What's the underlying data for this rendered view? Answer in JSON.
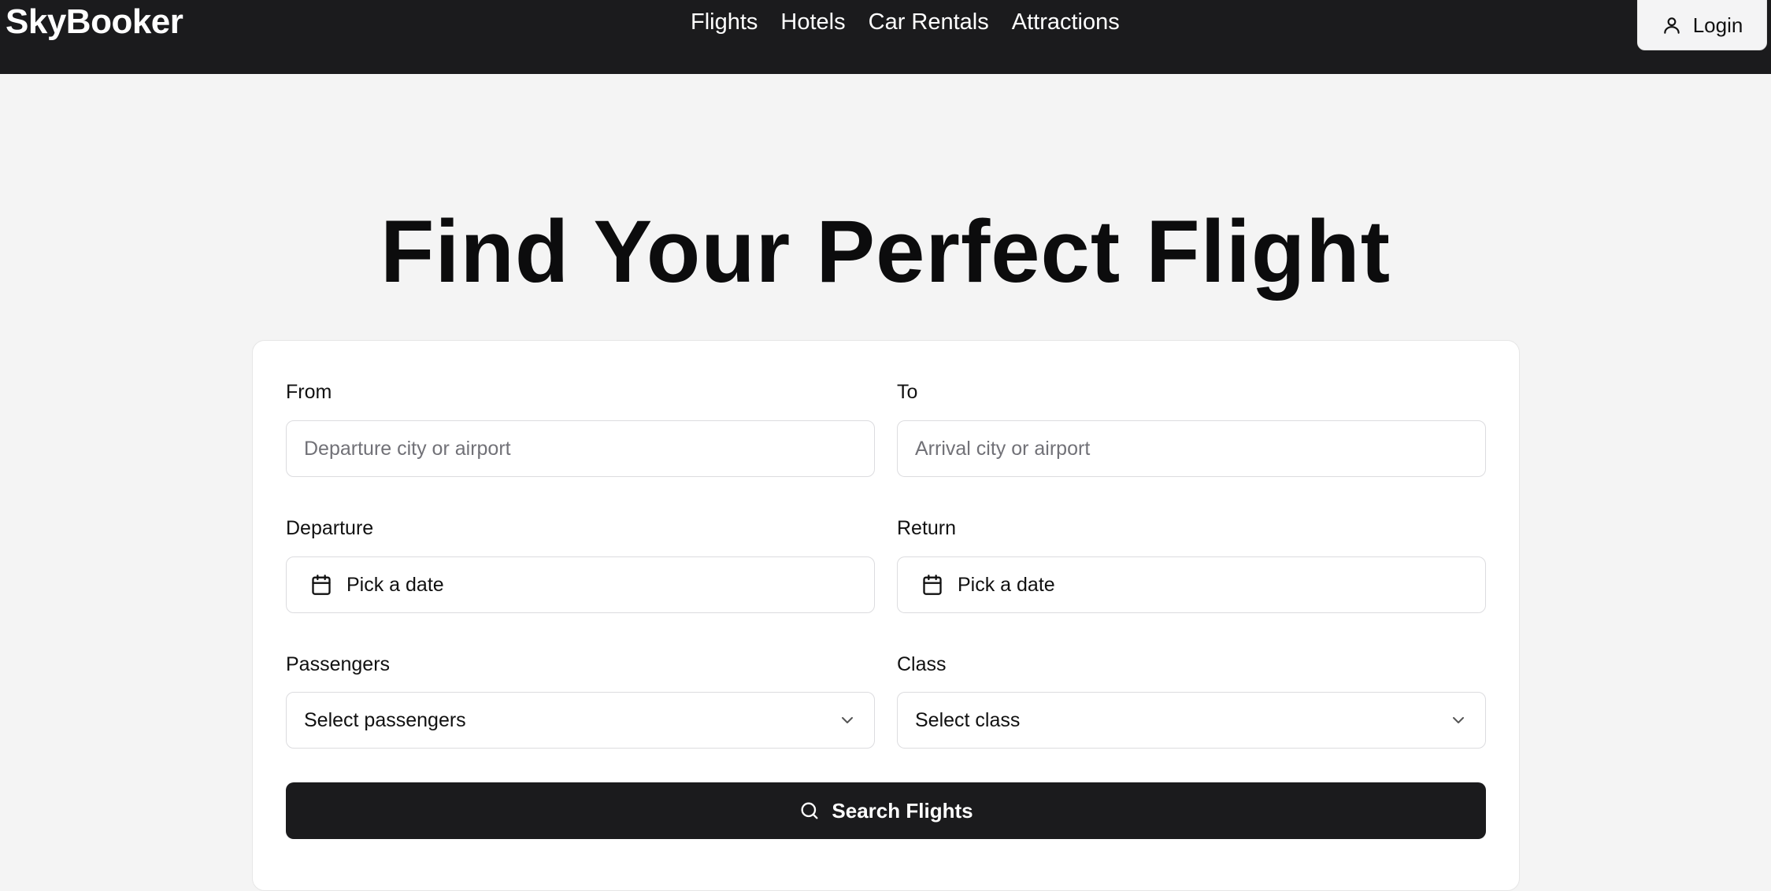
{
  "nav": {
    "brand": "SkyBooker",
    "links": [
      "Flights",
      "Hotels",
      "Car Rentals",
      "Attractions"
    ],
    "login_label": "Login"
  },
  "hero": {
    "title": "Find Your Perfect Flight"
  },
  "form": {
    "from": {
      "label": "From",
      "placeholder": "Departure city or airport"
    },
    "to": {
      "label": "To",
      "placeholder": "Arrival city or airport"
    },
    "departure": {
      "label": "Departure",
      "value": "Pick a date",
      "icon": "calendar-icon"
    },
    "return": {
      "label": "Return",
      "value": "Pick a date",
      "icon": "calendar-icon"
    },
    "passengers": {
      "label": "Passengers",
      "value": "Select passengers",
      "icon": "chevron-down-icon"
    },
    "class": {
      "label": "Class",
      "value": "Select class",
      "icon": "chevron-down-icon"
    },
    "search_label": "Search Flights"
  },
  "colors": {
    "nav_bg": "#1b1b1d",
    "page_bg": "#f4f4f4",
    "button_bg": "#1b1b1d"
  }
}
